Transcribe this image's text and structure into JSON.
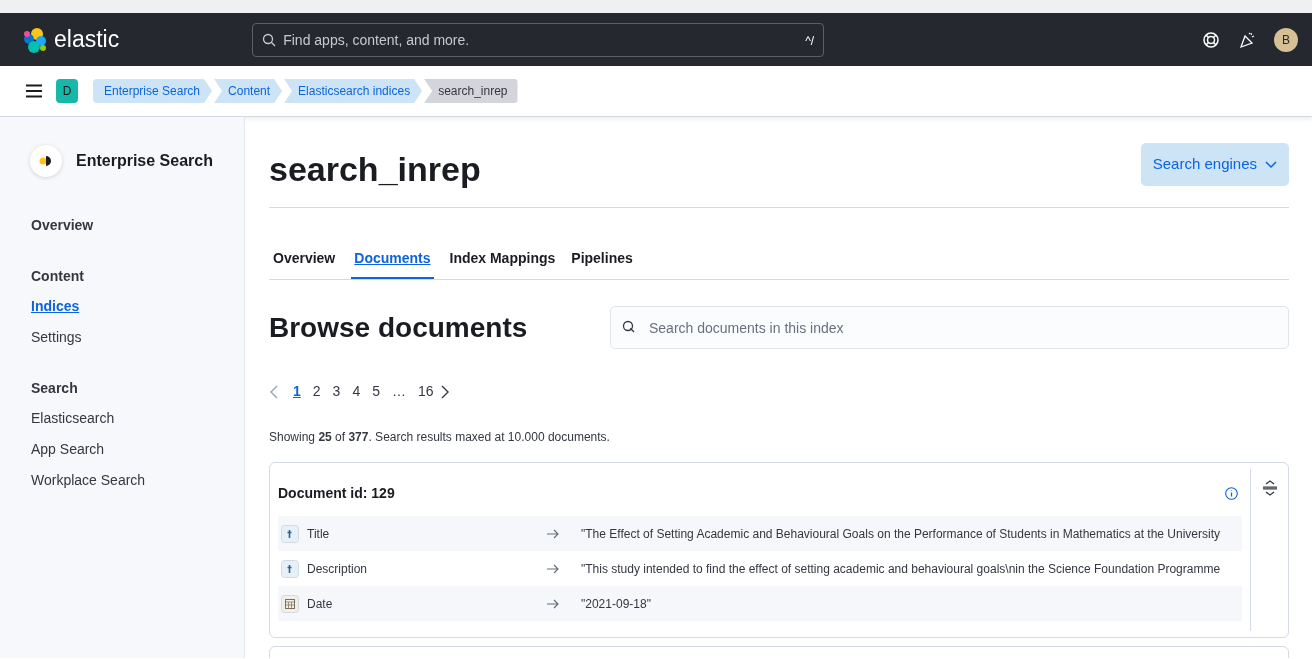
{
  "header": {
    "logo_text": "elastic",
    "search": {
      "placeholder": "Find apps, content, and more.",
      "shortcut": "^/"
    },
    "avatar": "B"
  },
  "breadcrumb_bar": {
    "space": "D",
    "crumbs": [
      {
        "label": "Enterprise Search",
        "selected": false
      },
      {
        "label": "Content",
        "selected": false
      },
      {
        "label": "Elasticsearch indices",
        "selected": false
      },
      {
        "label": "search_inrep",
        "selected": true
      }
    ]
  },
  "sidebar": {
    "title": "Enterprise Search",
    "sections": [
      {
        "heading": "Overview"
      },
      {
        "heading": "Content",
        "items": [
          {
            "label": "Indices",
            "selected": true
          },
          {
            "label": "Settings",
            "selected": false
          }
        ]
      },
      {
        "heading": "Search",
        "items": [
          {
            "label": "Elasticsearch",
            "selected": false
          },
          {
            "label": "App Search",
            "selected": false
          },
          {
            "label": "Workplace Search",
            "selected": false
          }
        ]
      }
    ]
  },
  "page": {
    "title": "search_inrep",
    "action_button": "Search engines",
    "tabs": [
      {
        "label": "Overview",
        "selected": false
      },
      {
        "label": "Documents",
        "selected": true
      },
      {
        "label": "Index Mappings",
        "selected": false
      },
      {
        "label": "Pipelines",
        "selected": false
      }
    ],
    "section_title": "Browse documents",
    "search": {
      "placeholder": "Search documents in this index"
    },
    "pagination": [
      {
        "label": "1",
        "selected": true
      },
      {
        "label": "2",
        "selected": false
      },
      {
        "label": "3",
        "selected": false
      },
      {
        "label": "4",
        "selected": false
      },
      {
        "label": "5",
        "selected": false
      },
      {
        "label": "…",
        "selected": false
      },
      {
        "label": "16",
        "selected": false
      }
    ],
    "summary": "Showing **25** of **377**. Search results maxed at 10.000 documents.",
    "documents": [
      {
        "title": "Document id: 129",
        "fields": [
          {
            "kind": "text",
            "name": "Title",
            "value": "\"The Effect of Setting Academic and Behavioural Goals on the Performance of Students in Mathematics at the University"
          },
          {
            "kind": "text",
            "name": "Description",
            "value": "\"This study intended to find the effect of setting academic and behavioural goals\\nin the Science Foundation Programme"
          },
          {
            "kind": "date",
            "name": "Date",
            "value": "\"2021-09-18\""
          }
        ]
      }
    ]
  }
}
